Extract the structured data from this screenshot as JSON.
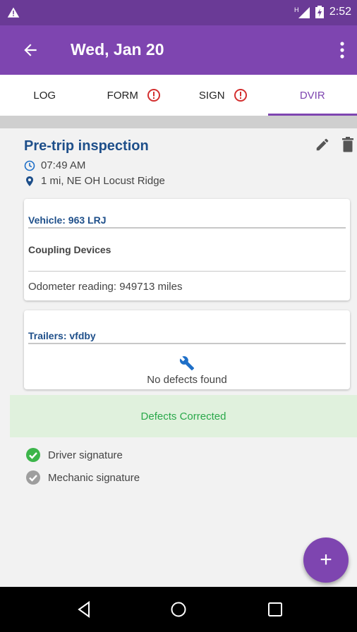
{
  "status_bar": {
    "time": "2:52",
    "network_label": "H"
  },
  "app_bar": {
    "title": "Wed, Jan 20"
  },
  "tabs": [
    {
      "label": "LOG",
      "alert": false,
      "active": false
    },
    {
      "label": "FORM",
      "alert": true,
      "active": false
    },
    {
      "label": "SIGN",
      "alert": true,
      "active": false
    },
    {
      "label": "DVIR",
      "alert": false,
      "active": true
    }
  ],
  "inspection": {
    "title": "Pre-trip inspection",
    "time": "07:49 AM",
    "location": "1 mi, NE OH Locust Ridge"
  },
  "vehicle_card": {
    "title": "Vehicle: 963 LRJ",
    "defect": "Coupling Devices",
    "odometer": "Odometer reading: 949713 miles"
  },
  "trailer_card": {
    "title": "Trailers: vfdby",
    "no_defects": "No defects found"
  },
  "banner": {
    "text": "Defects Corrected"
  },
  "signatures": {
    "driver": "Driver signature",
    "mechanic": "Mechanic signature"
  },
  "fab": {
    "label": "+"
  },
  "colors": {
    "primary": "#7e45b0",
    "primary_dark": "#6a3a96",
    "link_blue": "#1e4f8a",
    "success_green": "#2aa84a",
    "alert_red": "#d32f2f"
  }
}
